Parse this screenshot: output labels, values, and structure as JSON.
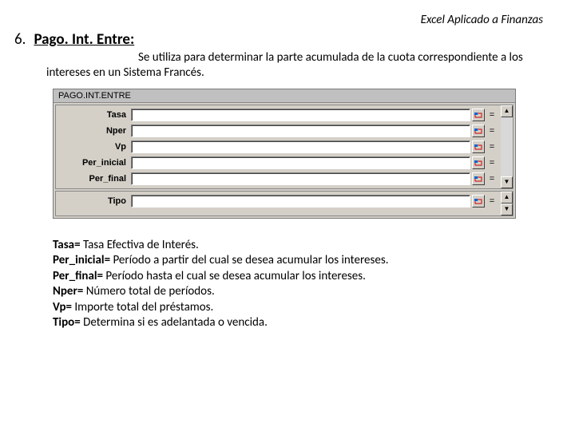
{
  "header": "Excel Aplicado a Finanzas",
  "section_num": "6.",
  "section_title": "Pago. Int. Entre:",
  "description": "Se utiliza para determinar la parte acumulada de la cuota correspondiente a los intereses en un Sistema Francés.",
  "dialog": {
    "title": "PAGO.INT.ENTRE",
    "panel1": [
      "Tasa",
      "Nper",
      "Vp",
      "Per_inicial",
      "Per_final"
    ],
    "panel2": [
      "Tipo"
    ]
  },
  "defs": [
    {
      "term": "Tasa=",
      "text": " Tasa Efectiva de Interés."
    },
    {
      "term": "Per_inicial=",
      "text": " Período a partir del cual se desea acumular los intereses."
    },
    {
      "term": "Per_final=",
      "text": " Período hasta el cual se desea acumular los intereses."
    },
    {
      "term": "Nper=",
      "text": " Número total de períodos."
    },
    {
      "term": "Vp=",
      "text": " Importe total del préstamos."
    },
    {
      "term": "Tipo=",
      "text": " Determina si es adelantada o vencida."
    }
  ]
}
